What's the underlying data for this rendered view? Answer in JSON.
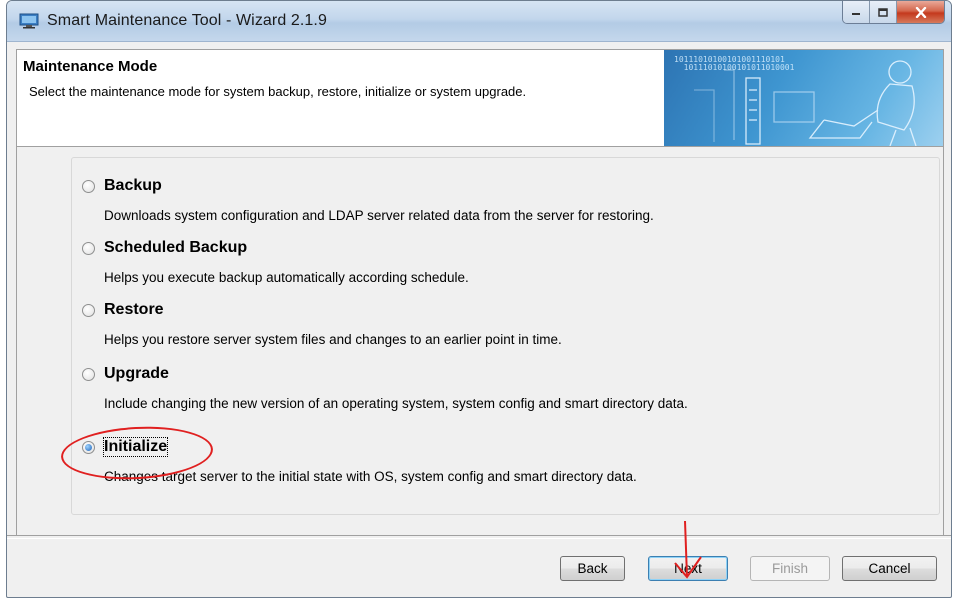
{
  "window": {
    "title": "Smart Maintenance Tool - Wizard 2.1.9"
  },
  "header": {
    "title": "Maintenance Mode",
    "description": "Select the maintenance mode for system backup, restore, initialize or system upgrade.",
    "banner_bits": "10111010100101001110101\n  10111010100101011010001"
  },
  "options": [
    {
      "label": "Backup",
      "description": "Downloads system configuration and LDAP server related data from the server for restoring.",
      "selected": false
    },
    {
      "label": "Scheduled Backup",
      "description": "Helps  you execute backup automatically according schedule.",
      "selected": false
    },
    {
      "label": "Restore",
      "description": "Helps you restore server system files and changes to an earlier point in time.",
      "selected": false
    },
    {
      "label": "Upgrade",
      "description": "Include changing the new version of an operating system, system config and smart directory data.",
      "selected": false
    },
    {
      "label": "Initialize",
      "description": "Changes target server to the initial state with OS, system config and smart directory data.",
      "selected": true
    }
  ],
  "buttons": {
    "back": "Back",
    "next": "Next",
    "finish": "Finish",
    "cancel": "Cancel"
  },
  "colors": {
    "annotation": "#e02020",
    "title_bar": "#c2d6ec",
    "banner": "#3e95d0"
  }
}
